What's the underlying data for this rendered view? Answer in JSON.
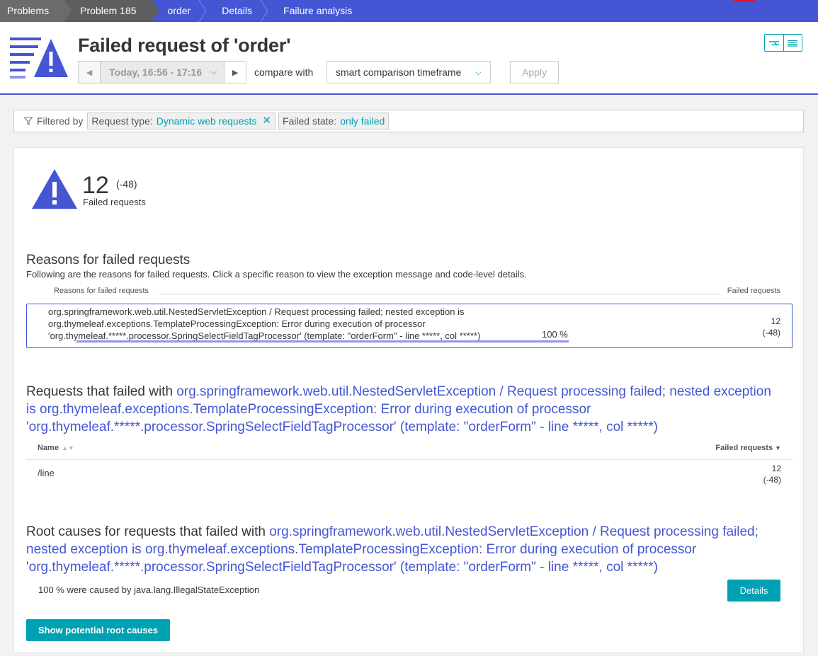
{
  "breadcrumb": [
    {
      "label": "Problems"
    },
    {
      "label": "Problem 185"
    },
    {
      "label": "order"
    },
    {
      "label": "Details"
    },
    {
      "label": "Failure analysis"
    }
  ],
  "header": {
    "title": "Failed request of 'order'",
    "timeframe": "Today, 16:56 - 17:16",
    "compare_label": "compare with",
    "compare_value": "smart comparison timeframe",
    "apply_label": "Apply"
  },
  "filter": {
    "label": "Filtered by",
    "chips": [
      {
        "key": "Request type:",
        "value": "Dynamic web requests"
      },
      {
        "key": "Failed state:",
        "value": "only failed"
      }
    ]
  },
  "kpi": {
    "value": "12",
    "delta": "(-48)",
    "label": "Failed requests"
  },
  "reasons": {
    "title": "Reasons for failed requests",
    "description": "Following are the reasons for failed requests. Click a specific reason to view the exception message and code-level details.",
    "col_reason": "Reasons for failed requests",
    "col_failed": "Failed requests",
    "row": {
      "text": "org.springframework.web.util.NestedServletException / Request processing failed; nested exception is org.thymeleaf.exceptions.TemplateProcessingException: Error during execution of processor 'org.thymeleaf.*****.processor.SpringSelectFieldTagProcessor' (template: \"orderForm\" - line *****, col *****)",
      "percent": "100 %",
      "share": 1.0,
      "count": "12",
      "delta": "(-48)"
    }
  },
  "requests": {
    "title_prefix": "Requests that failed with ",
    "title_link": "org.springframework.web.util.NestedServletException / Request processing failed; nested exception is org.thymeleaf.exceptions.TemplateProcessingException: Error during execution of processor 'org.thymeleaf.*****.processor.SpringSelectFieldTagProcessor' (template: \"orderForm\" - line *****, col *****)",
    "col_name": "Name",
    "col_failed": "Failed requests",
    "rows": [
      {
        "name": "/line",
        "count": "12",
        "delta": "(-48)"
      }
    ]
  },
  "root_causes": {
    "title_prefix": "Root causes for requests that failed with ",
    "title_link": "org.springframework.web.util.NestedServletException / Request processing failed; nested exception is org.thymeleaf.exceptions.TemplateProcessingException: Error during execution of processor 'org.thymeleaf.*****.processor.SpringSelectFieldTagProcessor' (template: \"orderForm\" - line *****, col *****)",
    "cause_text": "100 % were caused by java.lang.IllegalStateException",
    "details_label": "Details",
    "show_button": "Show potential root causes"
  },
  "colors": {
    "accent": "#4556d4",
    "teal": "#00a1b2",
    "bar": "#8b96ec"
  }
}
